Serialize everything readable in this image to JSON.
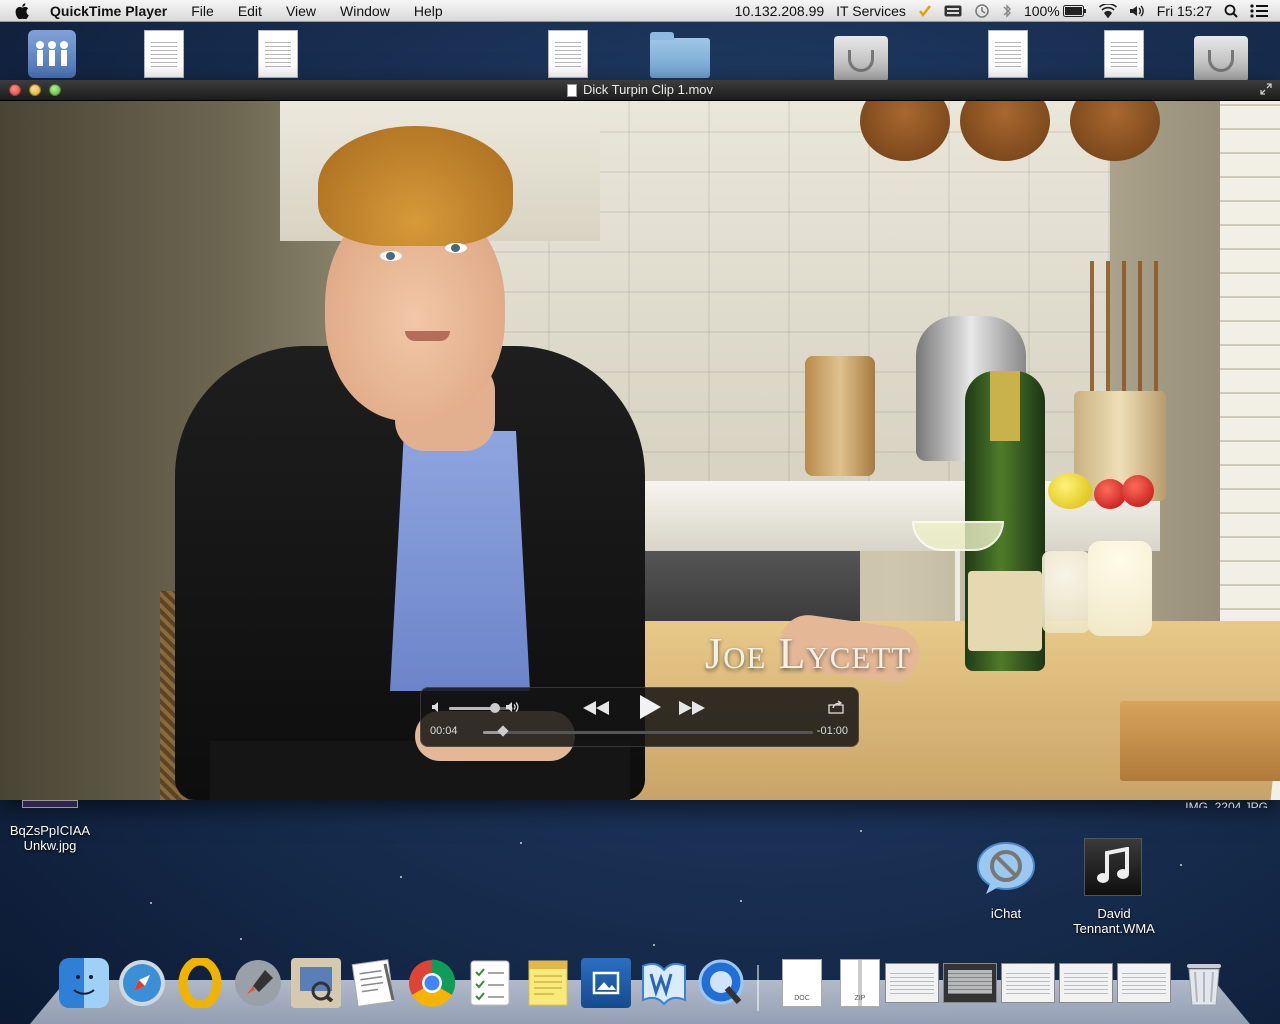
{
  "menubar": {
    "app_name": "QuickTime Player",
    "menus": [
      "File",
      "Edit",
      "View",
      "Window",
      "Help"
    ],
    "ip_address": "10.132.208.99",
    "user": "IT Services",
    "battery": "100%",
    "clock": "Fri 15:27"
  },
  "window": {
    "title": "Dick Turpin Clip 1.mov",
    "lower_third": "Joe Lycett"
  },
  "player": {
    "elapsed": "00:04",
    "remaining": "-01:00",
    "progress_fraction": 0.06,
    "volume_fraction": 0.72
  },
  "desktop": {
    "thumb_label": "BqZsPpICIAA Unkw.jpg",
    "ichat_label": "iChat",
    "music_label": "David Tennant.WMA"
  },
  "dock": {
    "doc_badge": "DOC",
    "zip_badge": "ZIP"
  },
  "colors": {
    "menubar_bg": "#e6e6e6",
    "hud_bg": "#141414",
    "desktop_bg": "#1b3358"
  }
}
